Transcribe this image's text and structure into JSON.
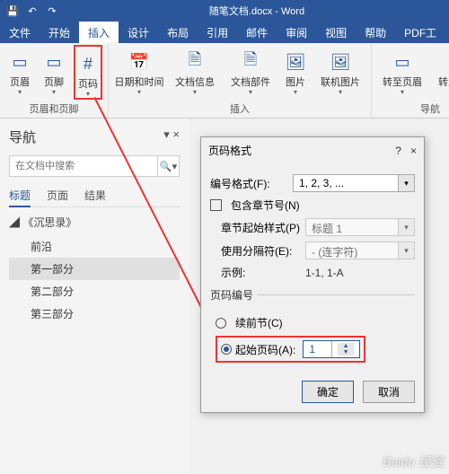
{
  "title": "随笔文档.docx - Word",
  "qat": {
    "save": "💾",
    "undo": "↶",
    "redo": "↷"
  },
  "tabs": [
    "文件",
    "开始",
    "插入",
    "设计",
    "布局",
    "引用",
    "邮件",
    "审阅",
    "视图",
    "帮助",
    "PDF工"
  ],
  "active_tab_index": 2,
  "ribbon": {
    "g1": {
      "name": "页眉和页脚",
      "items": [
        {
          "label": "页眉",
          "icon": "▭"
        },
        {
          "label": "页脚",
          "icon": "▭"
        },
        {
          "label": "页码",
          "icon": "#",
          "highlight": true
        }
      ]
    },
    "g2": {
      "name": "插入",
      "items": [
        {
          "label": "日期和时间",
          "icon": "📅"
        },
        {
          "label": "文档信息",
          "icon": "🗎"
        },
        {
          "label": "文档部件",
          "icon": "🗎"
        },
        {
          "label": "图片",
          "icon": "🖼"
        },
        {
          "label": "联机图片",
          "icon": "🖼"
        }
      ]
    },
    "g3": {
      "name": "导航",
      "items": [
        {
          "label": "转至页眉",
          "icon": "▭"
        },
        {
          "label": "转至页脚",
          "icon": "▭"
        }
      ]
    }
  },
  "nav": {
    "title": "导航",
    "search_placeholder": "在文档中搜索",
    "tabs": [
      "标题",
      "页面",
      "结果"
    ],
    "active_tab": 0,
    "tree": {
      "root": "《沉思录》",
      "items": [
        "前沿",
        "第一部分",
        "第二部分",
        "第三部分"
      ],
      "selected": 1
    }
  },
  "dialog": {
    "title": "页码格式",
    "help": "?",
    "close": "×",
    "format_label": "编号格式(F):",
    "format_value": "1, 2, 3, ...",
    "chapter_chk": "包含章节号(N)",
    "chapter_style_label": "章节起始样式(P)",
    "chapter_style_value": "标题 1",
    "sep_label": "使用分隔符(E):",
    "sep_value": "- (连字符)",
    "example_label": "示例:",
    "example_value": "1-1, 1-A",
    "numbering_legend": "页码编号",
    "radio_continue": "续前节(C)",
    "radio_start": "起始页码(A):",
    "start_value": "1",
    "ok": "确定",
    "cancel": "取消"
  },
  "watermark": "Baidu 经验"
}
